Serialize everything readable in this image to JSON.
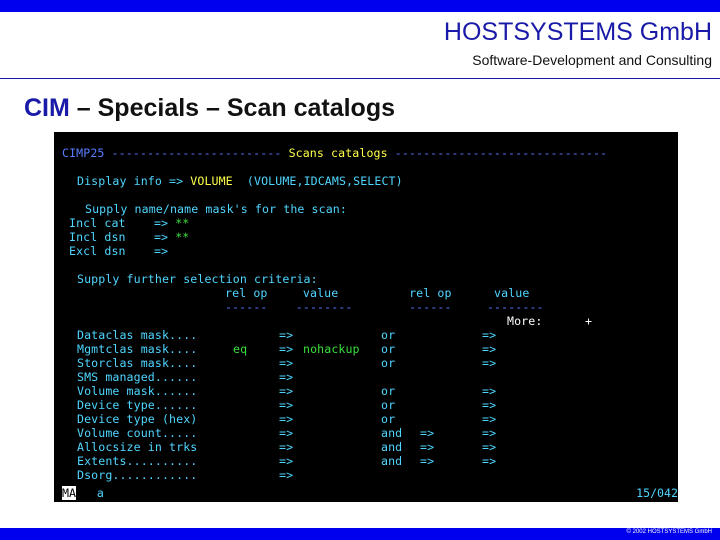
{
  "header": {
    "company": "HOSTSYSTEMS GmbH",
    "tagline": "Software-Development and Consulting"
  },
  "slide": {
    "title_prefix": "CIM",
    "title_rest": " – Specials – Scan catalogs"
  },
  "terminal": {
    "header_left": "CIMP25 ------------------------ ",
    "header_title": "Scans catalogs",
    "header_right": " ------------------------------",
    "display_label": "Display info => ",
    "display_value": "VOLUME",
    "display_options": "  (VOLUME,IDCAMS,SELECT)",
    "supply_mask": "Supply name/name mask's for the scan:",
    "incl_cat_label": "Incl cat    => ",
    "incl_cat_value": "**",
    "incl_dsn_label": "Incl dsn    => ",
    "incl_dsn_value": "**",
    "excl_dsn_label": "Excl dsn    =>",
    "supply_further": "Supply further selection criteria:",
    "col_header": "rel op     value          rel op      value",
    "col_divider": "------    --------        ------     --------",
    "more_label": "More:",
    "more_sign": "+",
    "criteria": [
      {
        "label": "Dataclas mask....",
        "relop": "",
        "arrow": "=>",
        "value": "",
        "conj": "or",
        "arrow2": "",
        "arrow3": "=>"
      },
      {
        "label": "Mgmtclas mask....",
        "relop": "eq",
        "arrow": "=>",
        "value": "nohackup",
        "conj": "or",
        "arrow2": "",
        "arrow3": "=>"
      },
      {
        "label": "Storclas mask....",
        "relop": "",
        "arrow": "=>",
        "value": "",
        "conj": "or",
        "arrow2": "",
        "arrow3": "=>"
      },
      {
        "label": "SMS managed......",
        "relop": "",
        "arrow": "=>",
        "value": "",
        "conj": "",
        "arrow2": "",
        "arrow3": ""
      },
      {
        "label": "Volume mask......",
        "relop": "",
        "arrow": "=>",
        "value": "",
        "conj": "or",
        "arrow2": "",
        "arrow3": "=>"
      },
      {
        "label": "Device type......",
        "relop": "",
        "arrow": "=>",
        "value": "",
        "conj": "or",
        "arrow2": "",
        "arrow3": "=>"
      },
      {
        "label": "Device type (hex)",
        "relop": "",
        "arrow": "=>",
        "value": "",
        "conj": "or",
        "arrow2": "",
        "arrow3": "=>"
      },
      {
        "label": "Volume count.....",
        "relop": "",
        "arrow": "=>",
        "value": "",
        "conj": "and",
        "arrow2": "=>",
        "arrow3": "=>"
      },
      {
        "label": "Allocsize in trks",
        "relop": "",
        "arrow": "=>",
        "value": "",
        "conj": "and",
        "arrow2": "=>",
        "arrow3": "=>"
      },
      {
        "label": "Extents..........",
        "relop": "",
        "arrow": "=>",
        "value": "",
        "conj": "and",
        "arrow2": "=>",
        "arrow3": "=>"
      },
      {
        "label": "Dsorg............",
        "relop": "",
        "arrow": "=>",
        "value": "",
        "conj": "",
        "arrow2": "",
        "arrow3": ""
      }
    ],
    "command_prefix": "MA",
    "command_value": "a",
    "position": "15/042"
  },
  "footer": {
    "copyright": "© 2002 HOSTSYSTEMS GmbH"
  },
  "colors": {
    "brand_blue": "#0000ee",
    "title_blue": "#1a1aa8",
    "terminal_cyan": "#4fd6ff",
    "terminal_green": "#39e03b",
    "terminal_yellow": "#ffff4a"
  }
}
